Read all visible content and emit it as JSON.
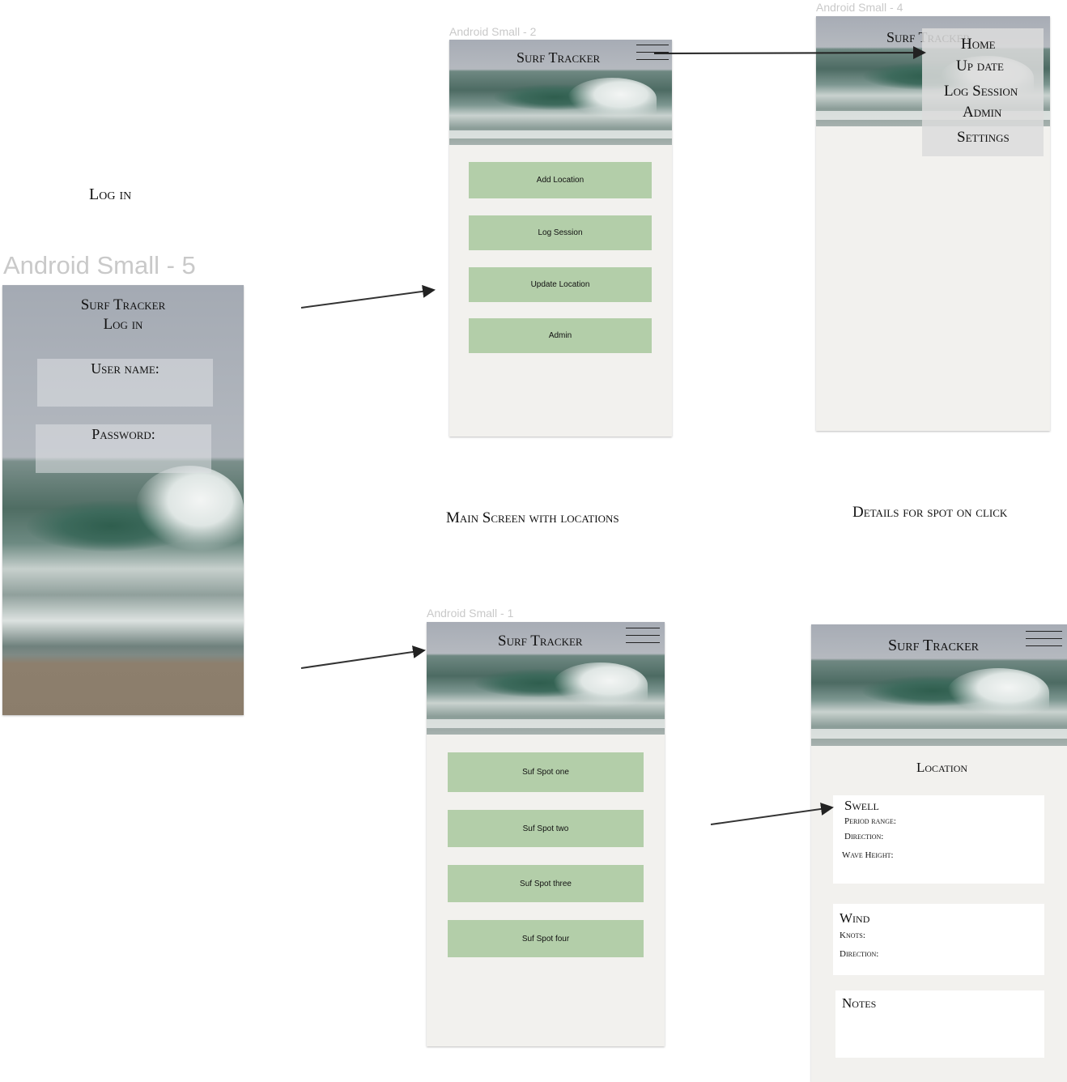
{
  "frames": {
    "login": "Android Small - 5",
    "main": "Android Small - 2",
    "menu": "Android Small - 4",
    "locations": "Android Small - 1"
  },
  "captions": {
    "login": "Log in",
    "main": "Main Screen with locations",
    "details": "Details for spot on click"
  },
  "app_title": "Surf Tracker",
  "login_screen": {
    "title": "Surf Tracker",
    "subtitle": "Log in",
    "username_label": "User name:",
    "password_label": "Password:"
  },
  "main_screen": {
    "buttons": [
      "Add Location",
      "Log Session",
      "Update Location",
      "Admin"
    ]
  },
  "menu_screen": {
    "items": [
      "Home",
      "Up date",
      "Log Session",
      "Admin",
      "Settings"
    ]
  },
  "locations_screen": {
    "spots": [
      "Suf Spot one",
      "Suf Spot two",
      "Suf Spot three",
      "Suf Spot four"
    ]
  },
  "details_screen": {
    "location_label": "Location",
    "swell": {
      "heading": "Swell",
      "period": "Period range:",
      "direction": "Direction:",
      "wave_height": "Wave Height:"
    },
    "wind": {
      "heading": "Wind",
      "knots": "Knots:",
      "direction": "Direction:"
    },
    "notes": {
      "heading": "Notes"
    }
  },
  "colors": {
    "button": "#b3cea9",
    "screen_bg": "#f2f1ee",
    "frame_label": "#c9c9c9"
  },
  "icons": [
    "hamburger-menu-icon",
    "flow-arrow"
  ]
}
